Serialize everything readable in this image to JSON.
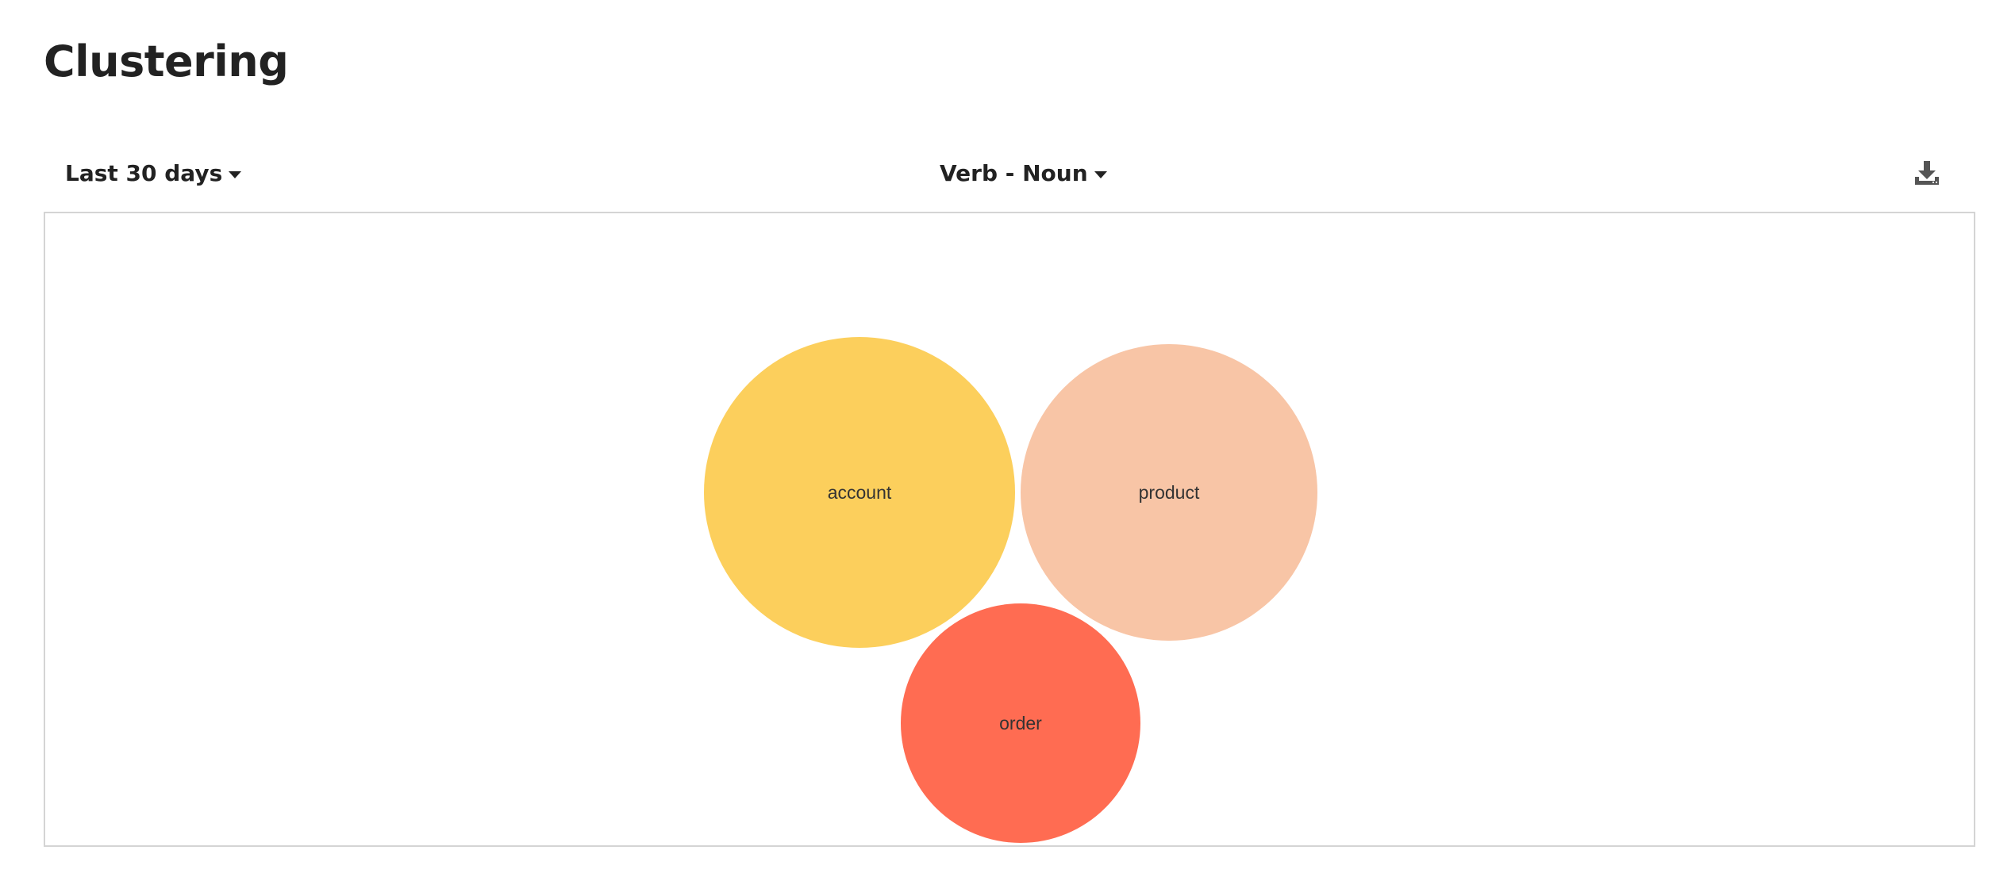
{
  "page": {
    "title": "Clustering"
  },
  "toolbar": {
    "date_range": {
      "selected": "Last 30 days",
      "icon": "caret-down-icon"
    },
    "clustering_mode": {
      "selected": "Verb - Noun",
      "icon": "caret-down-icon"
    },
    "download": {
      "icon": "download-icon"
    }
  },
  "chart_data": {
    "type": "bubble",
    "bubbles": [
      {
        "label": "account",
        "color": "#FCCF5C"
      },
      {
        "label": "product",
        "color": "#F8C5A6"
      },
      {
        "label": "order",
        "color": "#FF6C52"
      }
    ]
  }
}
